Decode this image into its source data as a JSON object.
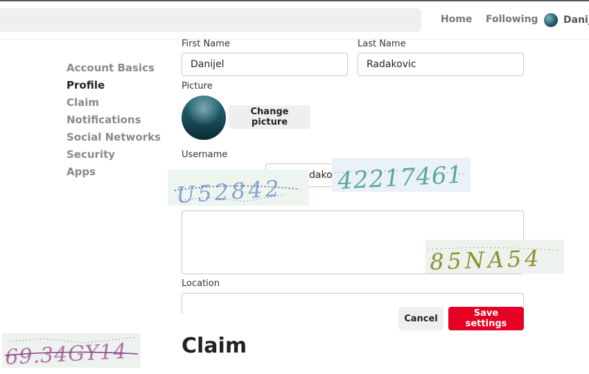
{
  "topbar": {
    "nav": {
      "home": "Home",
      "following": "Following"
    },
    "user": {
      "name": "Danijel"
    }
  },
  "sidebar": {
    "items": [
      {
        "label": "Account Basics",
        "active": false
      },
      {
        "label": "Profile",
        "active": true
      },
      {
        "label": "Claim",
        "active": false
      },
      {
        "label": "Notifications",
        "active": false
      },
      {
        "label": "Social Networks",
        "active": false
      },
      {
        "label": "Security",
        "active": false
      },
      {
        "label": "Apps",
        "active": false
      }
    ]
  },
  "form": {
    "first_name_label": "First Name",
    "first_name_value": "Danijel",
    "last_name_label": "Last Name",
    "last_name_value": "Radakovic",
    "picture_label": "Picture",
    "change_picture": "Change picture",
    "username_label": "Username",
    "username_value_visible": "dakov",
    "location_label": "Location",
    "cancel": "Cancel",
    "save": "Save settings"
  },
  "sections": {
    "claim_title": "Claim"
  },
  "captchas": [
    {
      "text": "U52842",
      "color": "#8aa3d0"
    },
    {
      "text": "42217461",
      "color": "#5aa89a"
    },
    {
      "text": "85NA54",
      "color": "#8f8f30"
    },
    {
      "text": "69.34GY14",
      "color": "#b070a8"
    }
  ],
  "colors": {
    "accent": "#e60023",
    "nav_text": "#777777"
  }
}
